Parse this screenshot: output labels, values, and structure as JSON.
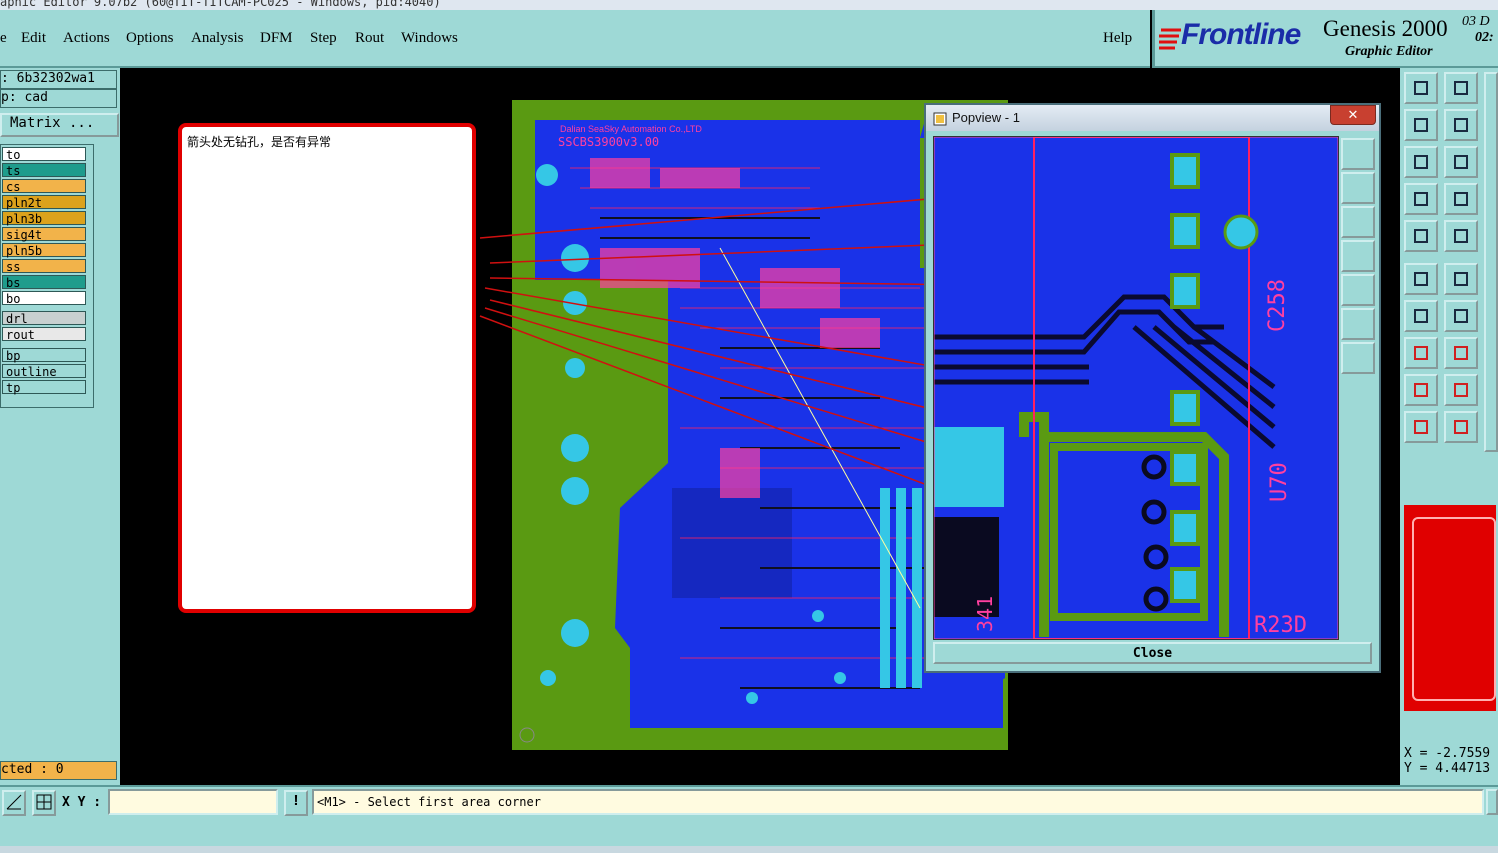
{
  "title_bar": {
    "text": "aphic Editor 9.07b2 (60@TIT-TITCAM-PC025 - Windows, pid:4040)"
  },
  "menu": {
    "items": [
      {
        "label": "e"
      },
      {
        "label": "Edit"
      },
      {
        "label": "Actions"
      },
      {
        "label": "Options"
      },
      {
        "label": "Analysis"
      },
      {
        "label": "DFM"
      },
      {
        "label": "Step"
      },
      {
        "label": "Rout"
      },
      {
        "label": "Windows"
      }
    ],
    "help": "Help"
  },
  "brand": {
    "logo": "Frontline",
    "product": "Genesis 2000",
    "subtitle": "Graphic Editor",
    "date": "03 D",
    "time": "02:"
  },
  "left_panel": {
    "job": ": 6b32302wa1",
    "step": "p: cad",
    "matrix_button": "Matrix ...",
    "layers_group1": [
      {
        "name": "to",
        "bg": "#ffffff"
      },
      {
        "name": "ts",
        "bg": "#1f9c8c"
      },
      {
        "name": "cs",
        "bg": "#f2b34a"
      },
      {
        "name": "pln2t",
        "bg": "#dca21c"
      },
      {
        "name": "pln3b",
        "bg": "#dca21c"
      },
      {
        "name": "sig4t",
        "bg": "#f2b34a"
      },
      {
        "name": "pln5b",
        "bg": "#f2b34a"
      },
      {
        "name": "ss",
        "bg": "#f2b34a"
      },
      {
        "name": "bs",
        "bg": "#1f9c8c"
      },
      {
        "name": "bo",
        "bg": "#ffffff"
      }
    ],
    "layers_group2": [
      {
        "name": "drl",
        "bg": "#c8d0d0"
      },
      {
        "name": "rout",
        "bg": "#e8e8e8"
      }
    ],
    "layers_group3": [
      {
        "name": "bp",
        "bg": "#9ed9d6"
      },
      {
        "name": "outline",
        "bg": "#9ed9d6"
      },
      {
        "name": "tp",
        "bg": "#9ed9d6"
      }
    ],
    "selected": "cted : 0"
  },
  "note": {
    "text": "箭头处无钻孔，是否有异常"
  },
  "board": {
    "header1": "Dalian SeaSky Automation Co.,LTD",
    "header2": "SSCBS3900v3.00"
  },
  "popview": {
    "title": "Popview - 1",
    "close_button": "Close",
    "labels": {
      "c258": "C258",
      "u70": "U70",
      "r23d": "R23D",
      "n341": "341"
    }
  },
  "coords": {
    "x": "X = -2.7559",
    "y": "Y = 4.44713"
  },
  "bottom": {
    "xy_label": "X Y :",
    "xy_value": "",
    "message": "<M1> - Select first area corner"
  },
  "colors": {
    "panel": "#9ed9d6",
    "board_green": "#5a9a12",
    "board_blue": "#1a32e8",
    "red_callout": "#e00000"
  }
}
